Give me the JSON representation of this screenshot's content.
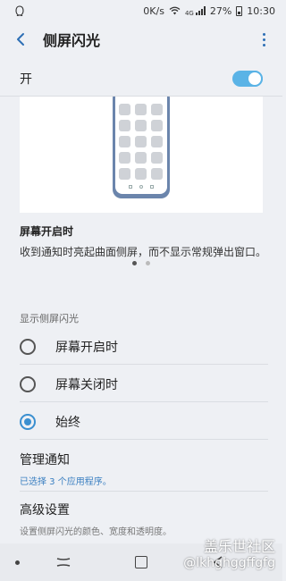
{
  "status_bar": {
    "network_speed": "0K/s",
    "network_type": "4G",
    "battery": "27%",
    "time": "10:30",
    "icons": [
      "assistant-icon",
      "wifi-icon",
      "signal-icon",
      "battery-icon"
    ]
  },
  "app_bar": {
    "title": "侧屏闪光",
    "back_icon": "back-arrow-icon",
    "more_icon": "more-vert-icon"
  },
  "master_switch": {
    "label": "开",
    "on": true
  },
  "preview": {
    "heading": "屏幕开启时",
    "description": "收到通知时亮起曲面侧屏，而不显示常规弹出窗口。",
    "page_count": 2,
    "current_page": 1
  },
  "display_section": {
    "title": "显示侧屏闪光",
    "options": [
      {
        "label": "屏幕开启时",
        "checked": false
      },
      {
        "label": "屏幕关闭时",
        "checked": false
      },
      {
        "label": "始终",
        "checked": true
      }
    ]
  },
  "manage_notifications": {
    "title": "管理通知",
    "summary": "已选择 3 个应用程序。"
  },
  "advanced_settings": {
    "title": "高级设置",
    "summary": "设置侧屏闪光的颜色、宽度和透明度。"
  },
  "watermark": {
    "line1": "盖乐世社区",
    "line2": "@lkhghggffgfg"
  },
  "colors": {
    "accent": "#3a8fd0",
    "toggle": "#5ab3e6",
    "background": "#eef0f4"
  }
}
